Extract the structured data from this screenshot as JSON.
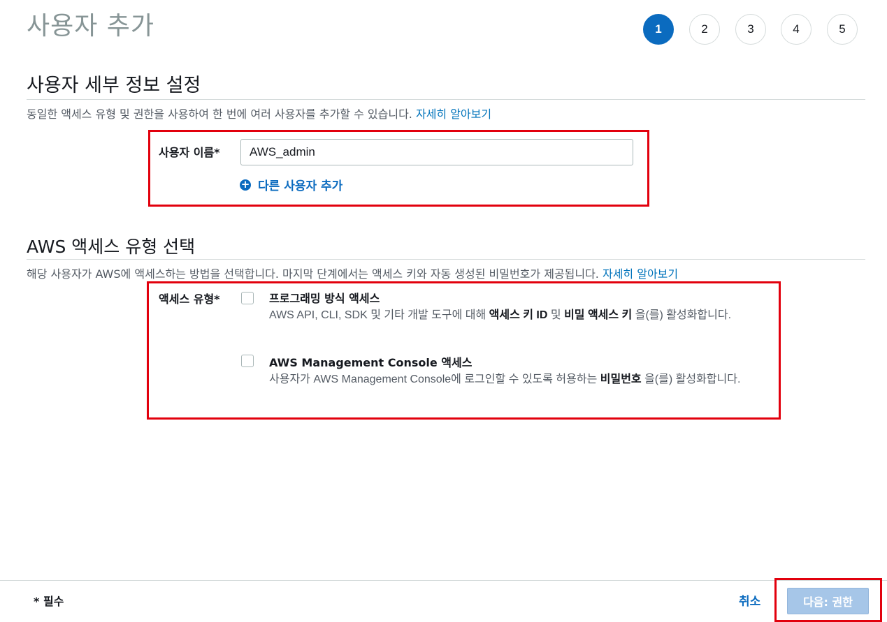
{
  "page": {
    "title": "사용자 추가"
  },
  "steps": [
    {
      "label": "1",
      "active": true
    },
    {
      "label": "2",
      "active": false
    },
    {
      "label": "3",
      "active": false
    },
    {
      "label": "4",
      "active": false
    },
    {
      "label": "5",
      "active": false
    }
  ],
  "user_details": {
    "heading": "사용자 세부 정보 설정",
    "description": "동일한 액세스 유형 및 권한을 사용하여 한 번에 여러 사용자를 추가할 수 있습니다. ",
    "learn_more": "자세히 알아보기",
    "username_label": "사용자 이름*",
    "username_value": "AWS_admin",
    "add_another_user": "다른 사용자 추가"
  },
  "access_type": {
    "heading": "AWS 액세스 유형 선택",
    "description": "해당 사용자가 AWS에 액세스하는 방법을 선택합니다. 마지막 단계에서는 액세스 키와 자동 생성된 비밀번호가 제공됩니다. ",
    "learn_more": "자세히 알아보기",
    "label": "액세스 유형*",
    "options": [
      {
        "title": "프로그래밍 방식 액세스",
        "desc_pre": "AWS API, CLI, SDK 및 기타 개발 도구에 대해 ",
        "desc_b1": "액세스 키 ID",
        "desc_mid": " 및 ",
        "desc_b2": "비밀 액세스 키",
        "desc_post": " 을(를) 활성화합니다.",
        "checked": false
      },
      {
        "title": "AWS Management Console 액세스",
        "desc_pre": "사용자가 AWS Management Console에 로그인할 수 있도록 허용하는 ",
        "desc_b1": "비밀번호",
        "desc_post": " 을(를) 활성화합니다.",
        "checked": false
      }
    ]
  },
  "footer": {
    "required_note": "* 필수",
    "cancel": "취소",
    "next": "다음: 권한"
  },
  "colors": {
    "accent": "#0b6bbf",
    "highlight": "#e2000d",
    "next_disabled": "#a6c6e8"
  }
}
